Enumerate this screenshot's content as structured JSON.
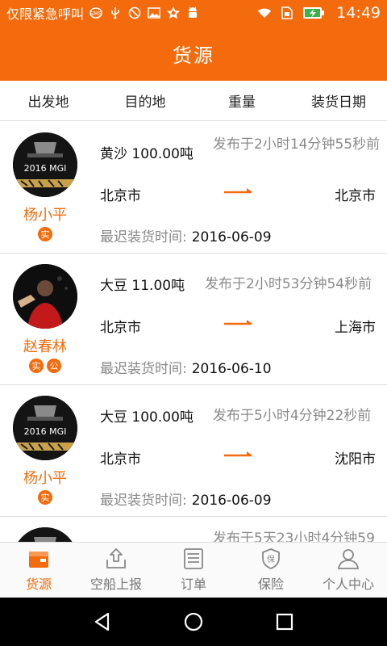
{
  "status_bar": {
    "carrier_text": "仅限紧急呼叫",
    "time": "14:49",
    "icons": [
      "sms-icon",
      "usb-icon",
      "no-notify-icon",
      "image-icon",
      "star-icon",
      "android-icon",
      "wifi-icon",
      "sim-icon",
      "battery-charging-icon"
    ]
  },
  "header": {
    "title": "货源"
  },
  "filters": [
    "出发地",
    "目的地",
    "重量",
    "装货日期"
  ],
  "load_date_label": "最迟装货时间:",
  "list": [
    {
      "name": "杨小平",
      "badges": [
        "实"
      ],
      "goods": "黄沙 100.00吨",
      "posted": "发布于2小时14分钟55秒前",
      "origin": "北京市",
      "destination": "北京市",
      "load_date": "2016-06-09"
    },
    {
      "name": "赵春林",
      "badges": [
        "实",
        "公"
      ],
      "goods": "大豆 11.00吨",
      "posted": "发布于2小时53分钟54秒前",
      "origin": "北京市",
      "destination": "上海市",
      "load_date": "2016-06-10"
    },
    {
      "name": "杨小平",
      "badges": [
        "实"
      ],
      "goods": "大豆 100.00吨",
      "posted": "发布于5小时4分钟22秒前",
      "origin": "北京市",
      "destination": "沈阳市",
      "load_date": "2016-06-09"
    },
    {
      "name": "",
      "badges": [],
      "goods": "",
      "posted": "发布于5天23小时4分钟59",
      "origin": "",
      "destination": "",
      "load_date": ""
    }
  ],
  "tabs": [
    {
      "label": "货源",
      "icon": "cargo-icon",
      "active": true
    },
    {
      "label": "空船上报",
      "icon": "upload-icon",
      "active": false
    },
    {
      "label": "订单",
      "icon": "order-list-icon",
      "active": false
    },
    {
      "label": "保险",
      "icon": "insurance-shield-icon",
      "active": false
    },
    {
      "label": "个人中心",
      "icon": "user-icon",
      "active": false
    }
  ],
  "colors": {
    "brand": "#f36b0c",
    "muted": "#8a8a8a",
    "divider": "#dcdcdc"
  }
}
